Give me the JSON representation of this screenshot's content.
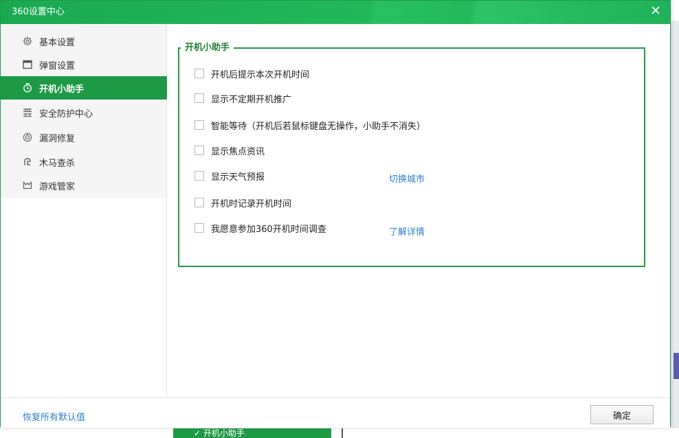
{
  "window": {
    "title": "360设置中心",
    "close_glyph": "✕",
    "background_peek_text": "✓ 开机小助手"
  },
  "sidebar": {
    "items": [
      {
        "label": "基本设置",
        "icon": "gear-icon",
        "active": false
      },
      {
        "label": "弹窗设置",
        "icon": "window-icon",
        "active": false
      },
      {
        "label": "开机小助手",
        "icon": "timer-icon",
        "active": true
      },
      {
        "label": "安全防护中心",
        "icon": "shield-grid-icon",
        "active": false
      },
      {
        "label": "漏洞修复",
        "icon": "repair-icon",
        "active": false
      },
      {
        "label": "木马查杀",
        "icon": "trojan-icon",
        "active": false
      },
      {
        "label": "游戏管家",
        "icon": "game-icon",
        "active": false
      }
    ]
  },
  "panel": {
    "legend": "开机小助手",
    "options": [
      {
        "label": "开机后提示本次开机时间",
        "checked": false
      },
      {
        "label": "显示不定期开机推广",
        "checked": false
      },
      {
        "label": "智能等待（开机后若鼠标键盘无操作，小助手不消失）",
        "checked": false
      },
      {
        "label": "显示焦点资讯",
        "checked": false
      },
      {
        "label": "显示天气预报",
        "checked": false
      },
      {
        "label": "开机时记录开机时间",
        "checked": false
      },
      {
        "label": "我愿意参加360开机时间调查",
        "checked": false
      }
    ],
    "links": {
      "switch_city": "切换城市",
      "learn_more": "了解详情"
    }
  },
  "footer": {
    "restore_defaults": "恢复所有默认值",
    "ok": "确定"
  },
  "colors": {
    "brand_green": "#1e9a47",
    "title_green": "#1db158",
    "link_blue": "#2c7fd0"
  }
}
